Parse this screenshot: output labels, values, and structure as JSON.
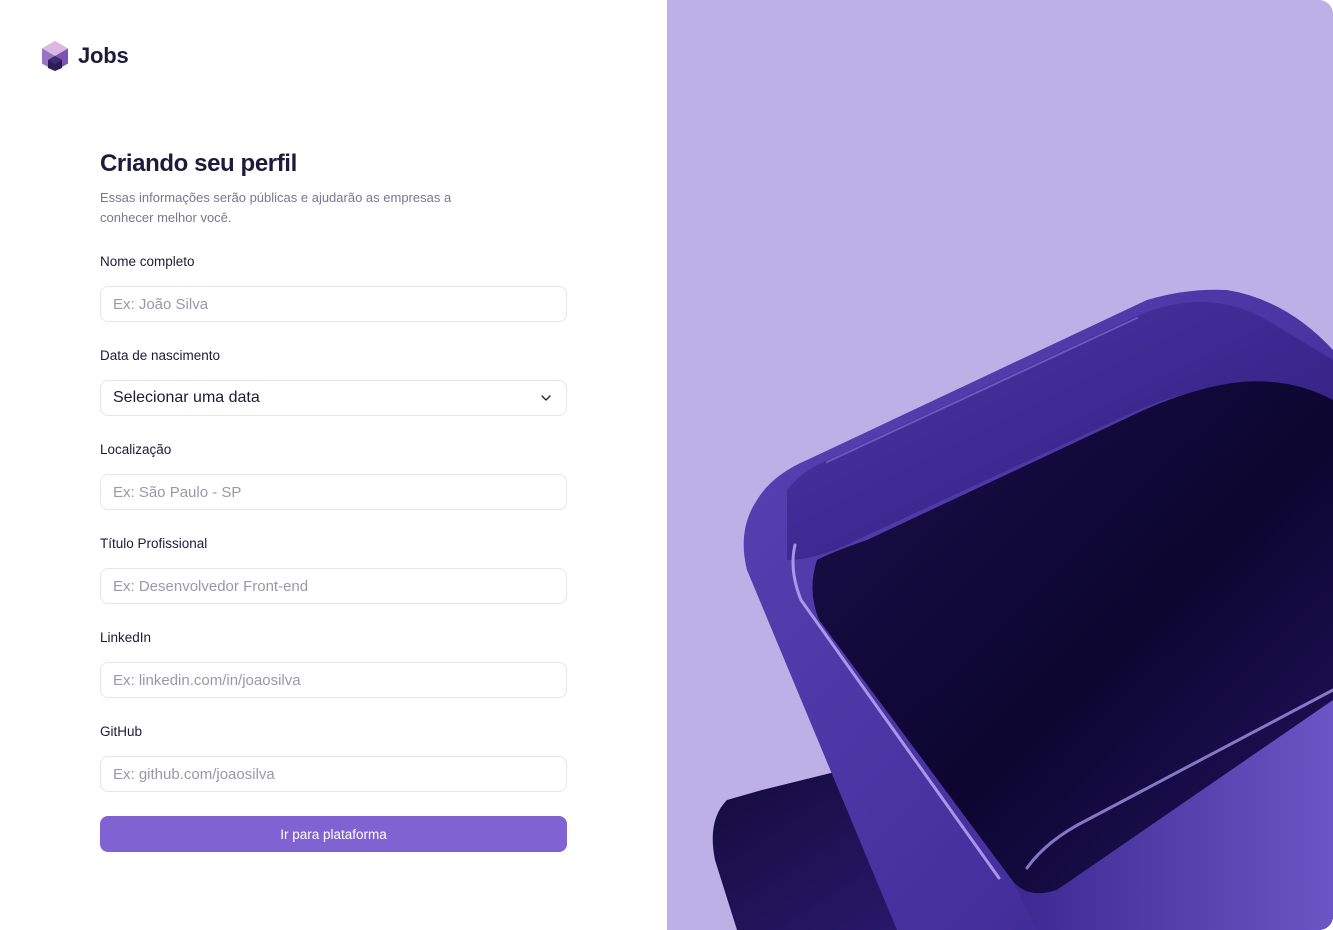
{
  "brand": {
    "name": "Jobs",
    "logo_icon": "hexagon-cube-icon",
    "accent_color": "#8062d2"
  },
  "form": {
    "title": "Criando seu perfil",
    "subtitle": "Essas informações serão públicas e ajudarão as empresas a conhecer melhor você.",
    "fields": [
      {
        "label": "Nome completo",
        "placeholder": "Ex: João Silva",
        "value": ""
      },
      {
        "label": "Data de nascimento",
        "type": "select",
        "value": "Selecionar uma data"
      },
      {
        "label": "Localização",
        "placeholder": "Ex: São Paulo - SP",
        "value": ""
      },
      {
        "label": "Título Profissional",
        "placeholder": "Ex: Desenvolvedor Front-end",
        "value": ""
      },
      {
        "label": "LinkedIn",
        "placeholder": "Ex: linkedin.com/in/joaosilva",
        "value": ""
      },
      {
        "label": "GitHub",
        "placeholder": "Ex: github.com/joaosilva",
        "value": ""
      }
    ],
    "submit_label": "Ir para plataforma"
  },
  "hero": {
    "background_color": "#bdb0e6",
    "illustration": "3d-cube-illustration"
  }
}
